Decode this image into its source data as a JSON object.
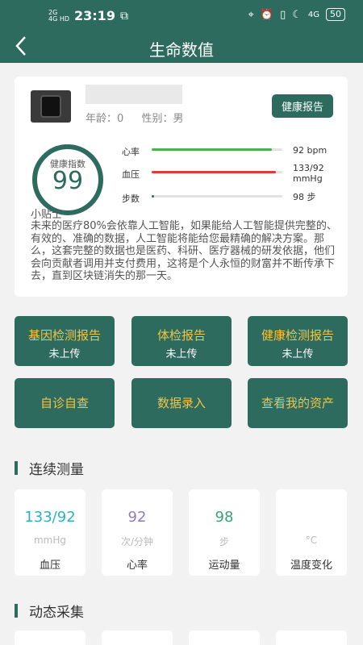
{
  "status_bar": {
    "signal_left": "2G",
    "signal_left_2": "4G HD",
    "time": "23:19",
    "battery": "50",
    "network": "4G"
  },
  "nav": {
    "title": "生命数值",
    "back_icon": "chevron-left-icon"
  },
  "profile": {
    "age_label": "年龄：",
    "age_value": "0",
    "gender_label": "性别：",
    "gender_value": "男",
    "health_report_button": "健康报告"
  },
  "health_index": {
    "label": "健康指数",
    "value": "99",
    "ring_fraction": 0.99
  },
  "metrics": [
    {
      "label": "心率",
      "value": "92 bpm",
      "color": "#4caf50",
      "fraction": 0.92
    },
    {
      "label": "血压",
      "value": "133/92 mmHg",
      "color": "#e53935",
      "fraction": 0.95
    },
    {
      "label": "步数",
      "value": "98 步",
      "color": "#2e6b5f",
      "fraction": 0.02
    }
  ],
  "tip": {
    "title": "小贴士",
    "text": "未来的医疗80%会依靠人工智能，如果能给人工智能提供完整的、有效的、准确的数据，人工智能将能给您最精确的解决方案。那么，这套完整的数据也是医药、科研、医疗器械的研发依据，他们会向贡献者调用并支付费用，这将是个人永恒的财富并不断传承下去，直到区块链消失的那一天。"
  },
  "tiles": [
    {
      "label": "基因检测报告",
      "sub": "未上传"
    },
    {
      "label": "体检报告",
      "sub": "未上传"
    },
    {
      "label": "健康检测报告",
      "sub": "未上传"
    },
    {
      "label": "自诊自查",
      "sub": ""
    },
    {
      "label": "数据录入",
      "sub": ""
    },
    {
      "label": "查看我的资产",
      "sub": ""
    }
  ],
  "continuous": {
    "title": "连续测量",
    "cards": [
      {
        "value": "133/92",
        "unit": "mmHg",
        "name": "血压",
        "color": "#26b5c8"
      },
      {
        "value": "92",
        "unit": "次/分钟",
        "name": "心率",
        "color": "#8e7cc3"
      },
      {
        "value": "98",
        "unit": "步",
        "name": "运动量",
        "color": "#3aa374"
      },
      {
        "value": "",
        "unit": "°C",
        "name": "温度变化",
        "color": "#cccccc"
      }
    ]
  },
  "dynamic": {
    "title": "动态采集"
  },
  "colors": {
    "primary": "#2e6b5f",
    "accent": "#f1c445"
  }
}
